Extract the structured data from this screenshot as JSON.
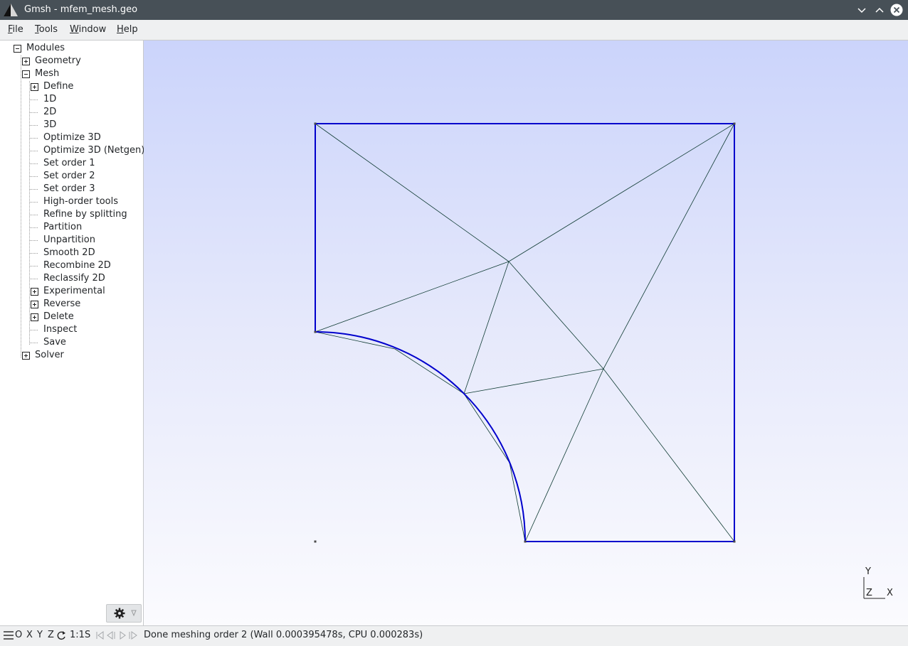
{
  "window": {
    "title": "Gmsh - mfem_mesh.geo",
    "controls": [
      "minimize",
      "maximize",
      "close"
    ]
  },
  "menubar": {
    "items": [
      {
        "label": "File"
      },
      {
        "label": "Tools"
      },
      {
        "label": "Window"
      },
      {
        "label": "Help"
      }
    ]
  },
  "tree": {
    "root": "Modules",
    "geometry": "Geometry",
    "mesh": "Mesh",
    "mesh_children": [
      "Define",
      "1D",
      "2D",
      "3D",
      "Optimize 3D",
      "Optimize 3D (Netgen)",
      "Set order 1",
      "Set order 2",
      "Set order 3",
      "High-order tools",
      "Refine by splitting",
      "Partition",
      "Unpartition",
      "Smooth 2D",
      "Recombine 2D",
      "Reclassify 2D",
      "Experimental",
      "Reverse",
      "Delete",
      "Inspect",
      "Save"
    ],
    "solver": "Solver"
  },
  "statusbar": {
    "buttons": [
      "O",
      "X",
      "Y",
      "Z",
      "1:1",
      "S"
    ],
    "message": "Done meshing order 2 (Wall 0.000395478s, CPU 0.000283s)"
  },
  "axes": {
    "y": "Y",
    "z": "Z",
    "x": "X"
  },
  "colors": {
    "titlebar": "#475057",
    "boundary_curve": "#0000cc",
    "mesh_edge": "#0f3b33",
    "background_top": "#cbd4fb",
    "background_bottom": "#fbfbfe"
  },
  "icons": {
    "app": "gmsh-logo-icon",
    "settings": "gear-icon",
    "status_menu": "hamburger-icon"
  }
}
